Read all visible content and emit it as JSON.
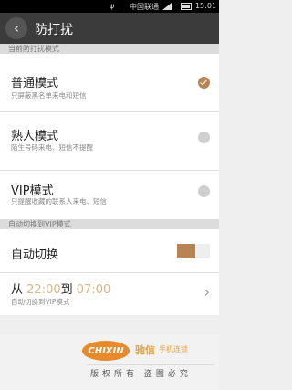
{
  "status": {
    "carrier": "中国联通",
    "time": "15:01",
    "usb": "ψ"
  },
  "header": {
    "back_icon": "chevron-left-icon",
    "back_glyph": "‹",
    "title": "防打扰"
  },
  "section_mode": "当前防打扰模式",
  "modes": [
    {
      "name": "普通模式",
      "desc": "只屏蔽黑名单来电和短信",
      "selected": true
    },
    {
      "name": "熟人模式",
      "desc": "陌生号码来电、短信不提醒",
      "selected": false
    },
    {
      "name": "VIP模式",
      "desc": "只提醒收藏的联系人来电、短信",
      "selected": false
    }
  ],
  "section_auto": "自动切换到VIP模式",
  "auto_switch": {
    "label": "自动切换",
    "on": true
  },
  "schedule": {
    "from_label": "从",
    "start": "22:00",
    "to_label": "到",
    "end": "07:00",
    "desc": "自动切换到VIP模式",
    "chevron": "›"
  },
  "footer": {
    "logo_text": "CHIXIN",
    "brand": "驰信",
    "brand_sub": "手机连锁",
    "copyright": "版权所有 盗图必究"
  },
  "colors": {
    "accent": "#b98454",
    "header": "#3b3b3b",
    "time_highlight": "#d9b48a"
  }
}
